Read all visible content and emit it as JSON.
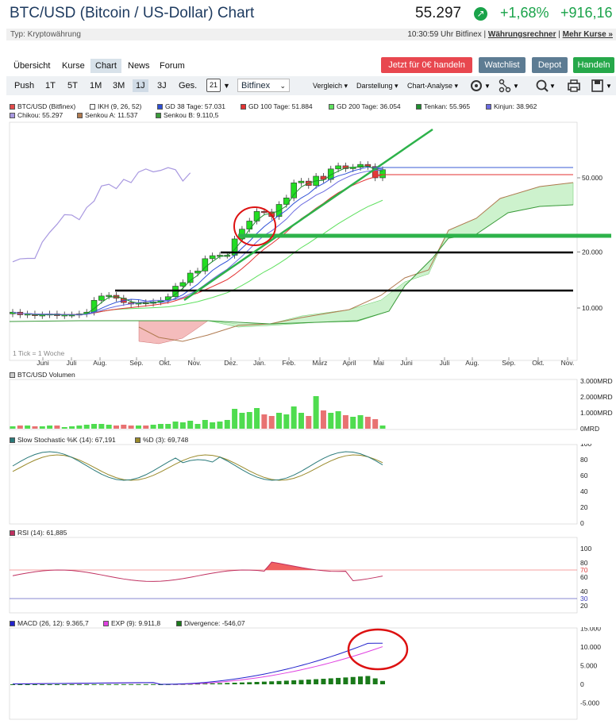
{
  "header": {
    "title": "BTC/USD (Bitcoin / US-Dollar) Chart",
    "price": "55.297",
    "change_pct": "+1,68%",
    "change_abs": "+916,16",
    "type_label": "Typ: Kryptowährung",
    "time_exchange": "10:30:59 Uhr Bitfinex |",
    "link_converter": "Währungsrechner",
    "link_more": "Mehr Kurse »",
    "separator": "|"
  },
  "nav": {
    "tabs": [
      "Übersicht",
      "Kurse",
      "Chart",
      "News",
      "Forum"
    ],
    "active": "Chart",
    "trade_button": "Jetzt für 0€ handeln",
    "watchlist_button": "Watchlist",
    "depot_button": "Depot",
    "handeln_button": "Handeln"
  },
  "toolbar": {
    "periods": [
      "Push",
      "1T",
      "5T",
      "1M",
      "3M",
      "1J",
      "3J",
      "Ges."
    ],
    "active_period": "1J",
    "calendar_label": "21",
    "exchange": "Bitfinex",
    "menus": [
      "Vergleich",
      "Darstellung",
      "Chart-Analyse"
    ]
  },
  "legend_main": [
    {
      "label": "BTC/USD (Bitfinex)",
      "color": "#e34a4a"
    },
    {
      "label": "IKH (9, 26, 52)",
      "color": "#ffffff"
    },
    {
      "label": "GD 38 Tage: 57.031",
      "color": "#2d4fd6"
    },
    {
      "label": "GD 100 Tage: 51.884",
      "color": "#e33232"
    },
    {
      "label": "GD 200 Tage: 36.054",
      "color": "#5fe05f"
    },
    {
      "label": "Tenkan: 55.965",
      "color": "#1f8f2f"
    },
    {
      "label": "Kinjun: 38.962",
      "color": "#6b6be0"
    },
    {
      "label": "Chikou: 55.297",
      "color": "#a898e0"
    },
    {
      "label": "Senkou A: 11.537",
      "color": "#b07a50"
    },
    {
      "label": "Senkou B: 9.110,5",
      "color": "#3a9a3a"
    }
  ],
  "main_chart": {
    "y_ticks": [
      "50.000",
      "20.000",
      "10.000"
    ],
    "x_ticks": [
      "Juni",
      "Juli",
      "Aug.",
      "Sep.",
      "Okt.",
      "Nov.",
      "Dez.",
      "Jan.",
      "Feb.",
      "März",
      "April",
      "Mai",
      "Juni",
      "Juli",
      "Aug.",
      "Sep.",
      "Okt.",
      "Nov."
    ],
    "note": "1 Tick = 1 Woche",
    "scale": "log"
  },
  "volume": {
    "legend": "BTC/USD Volumen",
    "y_ticks": [
      "3.000MRD",
      "2.000MRD",
      "1.000MRD",
      "0MRD"
    ]
  },
  "stochastic": {
    "legend_k": "Slow Stochastic %K (14): 67,191",
    "legend_d": "%D (3): 69,748",
    "y_ticks": [
      "100",
      "80",
      "60",
      "40",
      "20",
      "0"
    ]
  },
  "rsi": {
    "legend": "RSI (14): 61,885",
    "y_ticks": [
      "100",
      "80",
      "70",
      "60",
      "40",
      "30",
      "20"
    ]
  },
  "macd": {
    "legend_macd": "MACD (26, 12): 9.365,7",
    "legend_exp": "EXP (9): 9.911,8",
    "legend_div": "Divergence: -546,07",
    "y_ticks": [
      "15.000",
      "10.000",
      "5.000",
      "0",
      "-5.000"
    ]
  },
  "chart_data": {
    "type": "candlestick",
    "weekly_closes_approx": [
      9500,
      9200,
      9300,
      9100,
      9200,
      9300,
      9100,
      9200,
      9200,
      9300,
      9500,
      11000,
      11600,
      11700,
      11300,
      10700,
      10500,
      10700,
      10600,
      10800,
      11000,
      11500,
      13100,
      13700,
      15400,
      15800,
      18400,
      19100,
      19200,
      19200,
      23500,
      26500,
      29300,
      33000,
      32800,
      31000,
      36000,
      39000,
      47000,
      48000,
      45500,
      51000,
      49000,
      55800,
      58000,
      56000,
      57000,
      59000,
      57500,
      50000,
      55297
    ],
    "volume_mrd_approx": [
      0.15,
      0.2,
      0.2,
      0.15,
      0.15,
      0.2,
      0.2,
      0.1,
      0.15,
      0.2,
      0.25,
      0.3,
      0.3,
      0.25,
      0.2,
      0.25,
      0.2,
      0.2,
      0.2,
      0.25,
      0.3,
      0.3,
      0.45,
      0.4,
      0.5,
      0.3,
      0.55,
      0.4,
      0.45,
      0.55,
      1.25,
      1.0,
      1.05,
      1.3,
      0.9,
      0.8,
      1.0,
      0.9,
      1.4,
      1.0,
      0.8,
      2.05,
      1.15,
      1.0,
      1.1,
      0.85,
      0.75,
      0.85,
      0.75,
      0.6,
      0.2
    ]
  }
}
